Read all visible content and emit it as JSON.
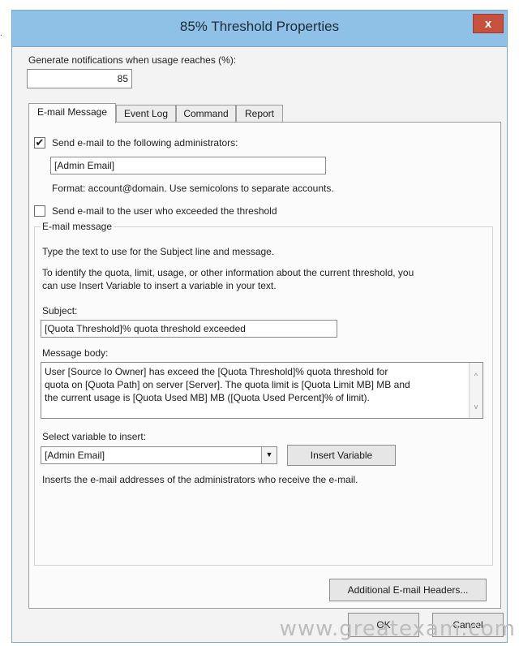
{
  "window": {
    "title": "85% Threshold Properties",
    "close_label": "x"
  },
  "threshold": {
    "label": "Generate notifications when usage reaches (%):",
    "value": "85"
  },
  "tabs": [
    {
      "label": "E-mail Message"
    },
    {
      "label": "Event Log"
    },
    {
      "label": "Command"
    },
    {
      "label": "Report"
    }
  ],
  "admins": {
    "checkbox_label": "Send e-mail to the following administrators:",
    "checked": true,
    "value": "[Admin Email]",
    "format_hint": "Format: account@domain. Use semicolons to separate accounts."
  },
  "user_notify": {
    "checkbox_label": "Send e-mail to the user who exceeded the threshold",
    "checked": false
  },
  "email_message": {
    "group_label": "E-mail message",
    "intro1": "Type the text to use for the Subject line and message.",
    "intro2_line1": "To identify the quota, limit, usage, or other information about the current threshold, you",
    "intro2_line2": "can use Insert Variable to insert a variable in your text.",
    "subject_label": "Subject:",
    "subject_value": "[Quota Threshold]% quota threshold exceeded",
    "body_label": "Message body:",
    "body_line1": "User [Source Io Owner] has exceed the [Quota Threshold]% quota threshold for",
    "body_line2": "quota on [Quota Path] on server [Server]. The quota limit is [Quota Limit MB] MB and",
    "body_line3": "the current usage is [Quota Used MB] MB ([Quota Used Percent]% of limit).",
    "var_label": "Select variable to insert:",
    "var_value": "[Admin Email]",
    "insert_button": "Insert Variable",
    "var_desc": "Inserts the e-mail addresses of the administrators who receive the e-mail."
  },
  "buttons": {
    "headers": "Additional E-mail Headers...",
    "ok": "OK",
    "cancel": "Cancel"
  },
  "watermark": "www.greatexam.com",
  "edge_mark": "."
}
